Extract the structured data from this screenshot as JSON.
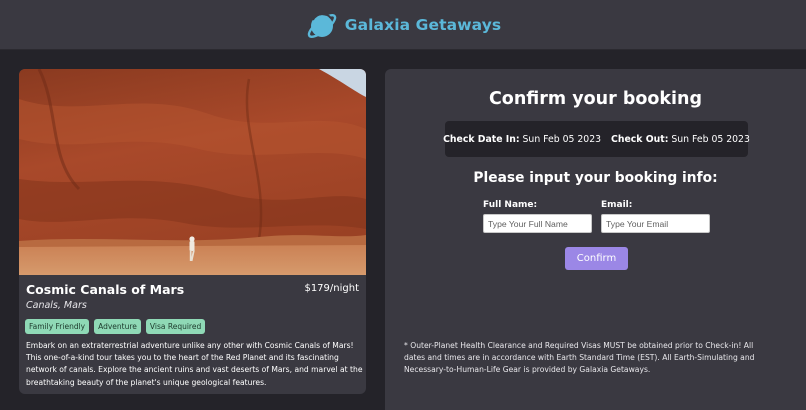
{
  "brand": {
    "name": "Galaxia Getaways",
    "logo_icon": "planet-icon",
    "color": "#5bb8d9"
  },
  "listing": {
    "title": "Cosmic Canals of Mars",
    "price": "$179/night",
    "location": "Canals, Mars",
    "tags": [
      "Family Friendly",
      "Adventure",
      "Visa Required"
    ],
    "tag_color": "#8fd9b6",
    "description": "Embark on an extraterrestrial adventure unlike any other with Cosmic Canals of Mars! This one-of-a-kind tour takes you to the heart of the Red Planet and its fascinating network of canals. Explore the ancient ruins and vast deserts of Mars, and marvel at the breathtaking beauty of the planet's unique geological features."
  },
  "booking": {
    "title": "Confirm your booking",
    "check_in_label": "Check Date In:",
    "check_in_value": "Sun Feb 05 2023",
    "check_out_label": "Check Out:",
    "check_out_value": "Sun Feb 05 2023",
    "subtitle": "Please input your booking info:",
    "full_name_label": "Full Name:",
    "full_name_placeholder": "Type Your Full Name",
    "full_name_value": "",
    "email_label": "Email:",
    "email_placeholder": "Type Your Email",
    "email_value": "",
    "confirm_label": "Confirm",
    "confirm_color": "#9b87e6",
    "disclaimer": "* Outer-Planet Health Clearance and Required Visas MUST be obtained prior to Check-in! All dates and times are in accordance with Earth Standard Time (EST). All Earth-Simulating and Necessary-to-Human-Life Gear is provided by Galaxia Getaways."
  }
}
